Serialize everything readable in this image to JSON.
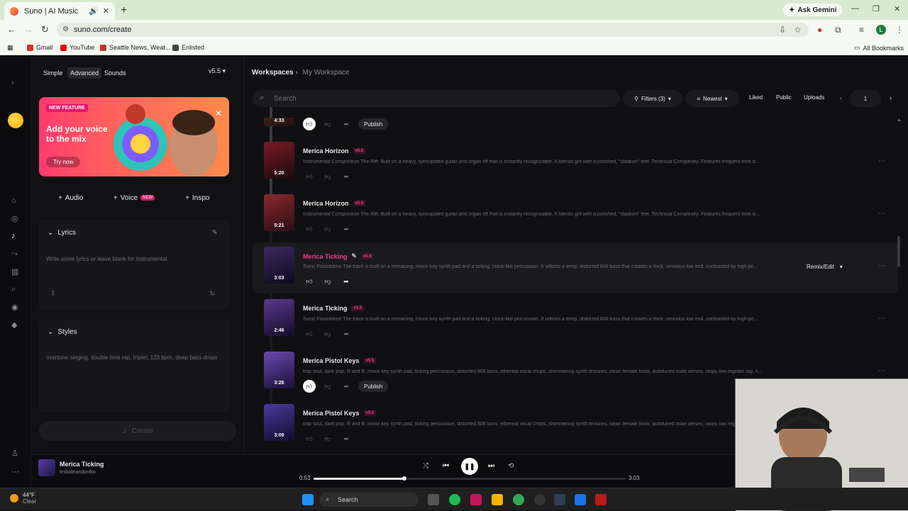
{
  "browser": {
    "tab_title": "Suno | AI Music",
    "url": "suno.com/create",
    "ask_gemini": "Ask Gemini",
    "profile_initial": "L",
    "bookmarks": [
      "Gmail",
      "YouTube",
      "Seattle News, Weat...",
      "Enlisted"
    ],
    "all_bookmarks": "All Bookmarks"
  },
  "left_panel": {
    "modes": [
      "Simple",
      "Advanced",
      "Sounds"
    ],
    "version": "v5.5",
    "banner": {
      "badge": "NEW FEATURE",
      "title": "Add your voice to the mix",
      "cta": "Try now"
    },
    "add_buttons": [
      {
        "label": "Audio"
      },
      {
        "label": "Voice",
        "badge": "NEW"
      },
      {
        "label": "Inspo"
      }
    ],
    "lyrics": {
      "label": "Lyrics",
      "placeholder": "Write some lyrics or leave blank for instrumental"
    },
    "styles": {
      "label": "Styles",
      "placeholder": "overtone singing, double time rap, triplet, 123 bpm, deep bass drops"
    },
    "create_label": "Create"
  },
  "workspace": {
    "breadcrumb_root": "Workspaces",
    "breadcrumb_current": "My Workspace",
    "search_placeholder": "Search",
    "filters_label": "Filters (3)",
    "sort_label": "Newest",
    "liked": "Liked",
    "public": "Public",
    "uploads": "Uploads",
    "page": "1",
    "publish_label": "Publish",
    "remix_label": "Remix/Edit"
  },
  "songs": [
    {
      "title": "",
      "duration": "4:33",
      "desc": "",
      "liked": true,
      "publish": true
    },
    {
      "title": "Merica Horizon",
      "tag": "v5.5",
      "duration": "5:20",
      "desc": "Instrumental Composition The Riff: Built on a heavy, syncopated guitar and organ riff that is instantly recognizable. It blends grit with a polished, \"stadium\" feel. Technical Complexity: Features frequent time si...",
      "liked": false,
      "publish": false
    },
    {
      "title": "Merica Horizon",
      "tag": "v5.5",
      "duration": "5:21",
      "desc": "Instrumental Composition The Riff: Built on a heavy, syncopated guitar and organ riff that is instantly recognizable. It blends grit with a polished, \"stadium\" feel. Technical Complexity: Features frequent time si...",
      "liked": false,
      "publish": false
    },
    {
      "title": "Merica Ticking",
      "tag": "v5.5",
      "duration": "3:03",
      "desc": "Sonic Foundation The track is built on a menacing, minor-key synth pad and a ticking, clock-like percussion. It utilizes a deep, distorted 808 bass that creates a thick, ominous low end, contrasted by high-pit...",
      "liked": false,
      "publish": false,
      "active": true
    },
    {
      "title": "Merica Ticking",
      "tag": "v5.5",
      "duration": "2:46",
      "desc": "Sonic Foundation The track is built on a menacing, minor-key synth pad and a ticking, clock-like percussion. It utilizes a deep, distorted 808 bass that creates a thick, ominous low end, contrasted by high-pit...",
      "liked": false,
      "publish": false
    },
    {
      "title": "Merica Pistol Keys",
      "tag": "v5.5",
      "duration": "3:26",
      "desc": "trap soul, dark pop, R and B, minor key synth pad, ticking percussion, distorted 808 bass, ethereal vocal chops, shimmering synth textures, clean female hook, autotuned male verses, raspy low register rap, s...",
      "liked": true,
      "publish": true
    },
    {
      "title": "Merica Pistol Keys",
      "tag": "v5.5",
      "duration": "3:09",
      "desc": "trap soul, dark pop, R and B, minor key synth pad, ticking percussion, distorted 808 bass, ethereal vocal chops, shimmering synth textures, clean female hook, autotuned male verses, raspy low register rap, s...",
      "liked": false,
      "publish": false
    }
  ],
  "player": {
    "title": "Merica Ticking",
    "user": "leskobrandonftw",
    "current": "0:53",
    "total": "3:03",
    "progress_fraction": 0.29
  },
  "taskbar": {
    "temp": "44°F",
    "condition": "Clear",
    "search": "Search"
  },
  "colors": {
    "accent": "#f03d8e",
    "background": "#101012",
    "browser_frame": "#d9ead3"
  }
}
